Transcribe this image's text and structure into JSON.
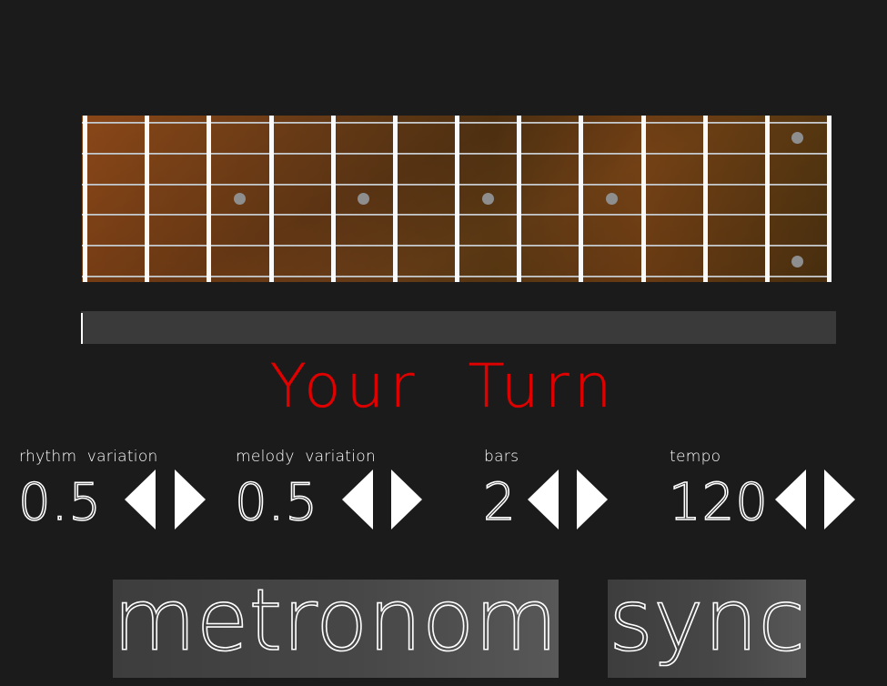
{
  "fretboard": {
    "strings": 6,
    "frets": 12,
    "inlay_frets_single": [
      3,
      5,
      7,
      9
    ],
    "inlay_fret_double": 12,
    "wood_color": "#7a4416",
    "fret_color": "#fafafa",
    "inlay_color": "#8e8e8e"
  },
  "progress": {
    "value": 0
  },
  "status": {
    "text": "Your Turn",
    "color": "#e00000"
  },
  "controls": {
    "rhythm_variation": {
      "label": "rhythm  variation",
      "value": "0.5",
      "decrease_icon": "triangle-left-icon",
      "increase_icon": "triangle-right-icon"
    },
    "melody_variation": {
      "label": "melody  variation",
      "value": "0.5",
      "decrease_icon": "triangle-left-icon",
      "increase_icon": "triangle-right-icon"
    },
    "bars": {
      "label": "bars",
      "value": "2",
      "decrease_icon": "triangle-left-icon",
      "increase_icon": "triangle-right-icon"
    },
    "tempo": {
      "label": "tempo",
      "value": "120",
      "decrease_icon": "triangle-left-icon",
      "increase_icon": "triangle-right-icon"
    }
  },
  "buttons": {
    "metronome": "metronome",
    "sync": "sync"
  }
}
